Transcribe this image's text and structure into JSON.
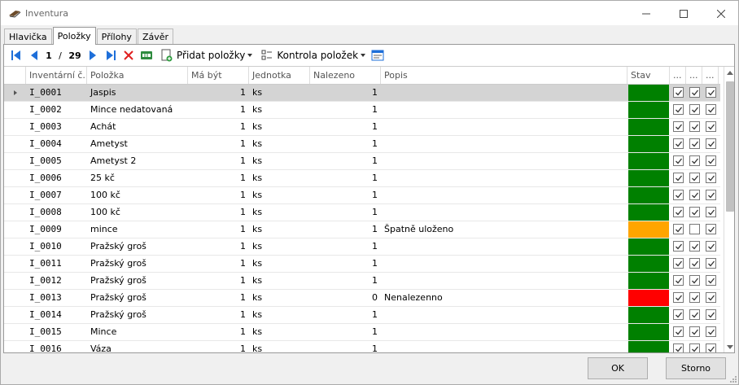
{
  "window": {
    "title": "Inventura",
    "icon": "inventory-book-icon"
  },
  "tabs": [
    {
      "label": "Hlavička",
      "active": false
    },
    {
      "label": "Položky",
      "active": true
    },
    {
      "label": "Přílohy",
      "active": false
    },
    {
      "label": "Závěr",
      "active": false
    }
  ],
  "toolbar": {
    "current_record": "1",
    "separator": "/",
    "total_records": "29",
    "add_items_label": "Přidat položky",
    "check_items_label": "Kontrola položek"
  },
  "grid": {
    "columns": [
      "Inventární č...",
      "Položka",
      "Má být",
      "Jednotka",
      "Nalezeno",
      "Popis",
      "Stav",
      "...",
      "...",
      "..."
    ],
    "status_colors": {
      "ok": "#008000",
      "warn": "#FFA500",
      "error": "#FF0000"
    },
    "rows": [
      {
        "inv": "I_0001",
        "item": "Jaspis",
        "expected": "1",
        "unit": "ks",
        "found": "1",
        "note": "",
        "status": "ok",
        "c1": true,
        "c2": true,
        "c3": true,
        "selected": true
      },
      {
        "inv": "I_0002",
        "item": "Mince nedatovaná",
        "expected": "1",
        "unit": "ks",
        "found": "1",
        "note": "",
        "status": "ok",
        "c1": true,
        "c2": true,
        "c3": true
      },
      {
        "inv": "I_0003",
        "item": "Achát",
        "expected": "1",
        "unit": "ks",
        "found": "1",
        "note": "",
        "status": "ok",
        "c1": true,
        "c2": true,
        "c3": true
      },
      {
        "inv": "I_0004",
        "item": "Ametyst",
        "expected": "1",
        "unit": "ks",
        "found": "1",
        "note": "",
        "status": "ok",
        "c1": true,
        "c2": true,
        "c3": true
      },
      {
        "inv": "I_0005",
        "item": "Ametyst 2",
        "expected": "1",
        "unit": "ks",
        "found": "1",
        "note": "",
        "status": "ok",
        "c1": true,
        "c2": true,
        "c3": true
      },
      {
        "inv": "I_0006",
        "item": "25 kč",
        "expected": "1",
        "unit": "ks",
        "found": "1",
        "note": "",
        "status": "ok",
        "c1": true,
        "c2": true,
        "c3": true
      },
      {
        "inv": "I_0007",
        "item": "100 kč",
        "expected": "1",
        "unit": "ks",
        "found": "1",
        "note": "",
        "status": "ok",
        "c1": true,
        "c2": true,
        "c3": true
      },
      {
        "inv": "I_0008",
        "item": "100 kč",
        "expected": "1",
        "unit": "ks",
        "found": "1",
        "note": "",
        "status": "ok",
        "c1": true,
        "c2": true,
        "c3": true
      },
      {
        "inv": "I_0009",
        "item": "mince",
        "expected": "1",
        "unit": "ks",
        "found": "1",
        "note": "Špatně uloženo",
        "status": "warn",
        "c1": true,
        "c2": false,
        "c3": true
      },
      {
        "inv": "I_0010",
        "item": "Pražský groš",
        "expected": "1",
        "unit": "ks",
        "found": "1",
        "note": "",
        "status": "ok",
        "c1": true,
        "c2": true,
        "c3": true
      },
      {
        "inv": "I_0011",
        "item": "Pražský groš",
        "expected": "1",
        "unit": "ks",
        "found": "1",
        "note": "",
        "status": "ok",
        "c1": true,
        "c2": true,
        "c3": true
      },
      {
        "inv": "I_0012",
        "item": "Pražský groš",
        "expected": "1",
        "unit": "ks",
        "found": "1",
        "note": "",
        "status": "ok",
        "c1": true,
        "c2": true,
        "c3": true
      },
      {
        "inv": "I_0013",
        "item": "Pražský groš",
        "expected": "1",
        "unit": "ks",
        "found": "0",
        "note": "Nenalezenno",
        "status": "error",
        "c1": true,
        "c2": true,
        "c3": true
      },
      {
        "inv": "I_0014",
        "item": "Pražský groš",
        "expected": "1",
        "unit": "ks",
        "found": "1",
        "note": "",
        "status": "ok",
        "c1": true,
        "c2": true,
        "c3": true
      },
      {
        "inv": "I_0015",
        "item": "Mince",
        "expected": "1",
        "unit": "ks",
        "found": "1",
        "note": "",
        "status": "ok",
        "c1": true,
        "c2": true,
        "c3": true
      },
      {
        "inv": "I_0016",
        "item": "Váza",
        "expected": "1",
        "unit": "ks",
        "found": "1",
        "note": "",
        "status": "ok",
        "c1": true,
        "c2": true,
        "c3": true
      }
    ]
  },
  "buttons": {
    "ok": "OK",
    "cancel": "Storno"
  }
}
